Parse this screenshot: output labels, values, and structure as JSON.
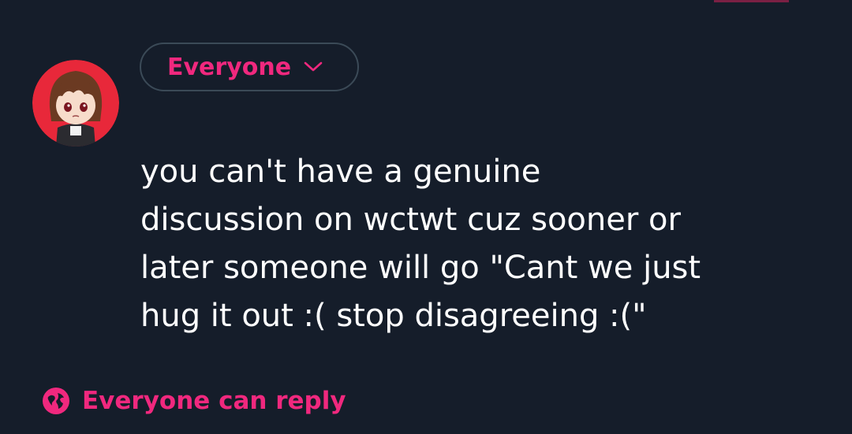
{
  "composer": {
    "audience_label": "Everyone",
    "text": "you can't have a genuine\ndiscussion on wctwt cuz sooner or\nlater someone will go \"Cant we just\nhug it out :( stop disagreeing :(\"",
    "reply_setting_label": "Everyone can reply"
  },
  "icons": {
    "audience_chevron": "chevron-down-icon",
    "reply_globe": "globe-icon"
  },
  "colors": {
    "background": "#151d2a",
    "accent": "#f0287e",
    "text": "#ffffff",
    "pill_border": "#3b4a57"
  }
}
